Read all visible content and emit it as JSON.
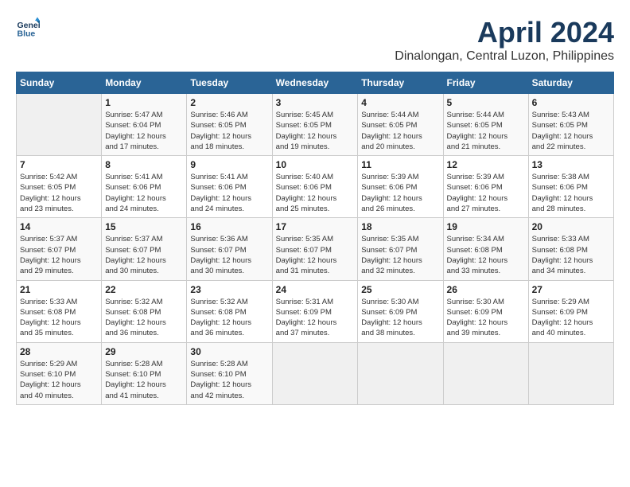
{
  "header": {
    "logo_line1": "General",
    "logo_line2": "Blue",
    "title": "April 2024",
    "subtitle": "Dinalongan, Central Luzon, Philippines"
  },
  "days_of_week": [
    "Sunday",
    "Monday",
    "Tuesday",
    "Wednesday",
    "Thursday",
    "Friday",
    "Saturday"
  ],
  "weeks": [
    [
      {
        "day": "",
        "info": ""
      },
      {
        "day": "1",
        "info": "Sunrise: 5:47 AM\nSunset: 6:04 PM\nDaylight: 12 hours\nand 17 minutes."
      },
      {
        "day": "2",
        "info": "Sunrise: 5:46 AM\nSunset: 6:05 PM\nDaylight: 12 hours\nand 18 minutes."
      },
      {
        "day": "3",
        "info": "Sunrise: 5:45 AM\nSunset: 6:05 PM\nDaylight: 12 hours\nand 19 minutes."
      },
      {
        "day": "4",
        "info": "Sunrise: 5:44 AM\nSunset: 6:05 PM\nDaylight: 12 hours\nand 20 minutes."
      },
      {
        "day": "5",
        "info": "Sunrise: 5:44 AM\nSunset: 6:05 PM\nDaylight: 12 hours\nand 21 minutes."
      },
      {
        "day": "6",
        "info": "Sunrise: 5:43 AM\nSunset: 6:05 PM\nDaylight: 12 hours\nand 22 minutes."
      }
    ],
    [
      {
        "day": "7",
        "info": "Sunrise: 5:42 AM\nSunset: 6:05 PM\nDaylight: 12 hours\nand 23 minutes."
      },
      {
        "day": "8",
        "info": "Sunrise: 5:41 AM\nSunset: 6:06 PM\nDaylight: 12 hours\nand 24 minutes."
      },
      {
        "day": "9",
        "info": "Sunrise: 5:41 AM\nSunset: 6:06 PM\nDaylight: 12 hours\nand 24 minutes."
      },
      {
        "day": "10",
        "info": "Sunrise: 5:40 AM\nSunset: 6:06 PM\nDaylight: 12 hours\nand 25 minutes."
      },
      {
        "day": "11",
        "info": "Sunrise: 5:39 AM\nSunset: 6:06 PM\nDaylight: 12 hours\nand 26 minutes."
      },
      {
        "day": "12",
        "info": "Sunrise: 5:39 AM\nSunset: 6:06 PM\nDaylight: 12 hours\nand 27 minutes."
      },
      {
        "day": "13",
        "info": "Sunrise: 5:38 AM\nSunset: 6:06 PM\nDaylight: 12 hours\nand 28 minutes."
      }
    ],
    [
      {
        "day": "14",
        "info": "Sunrise: 5:37 AM\nSunset: 6:07 PM\nDaylight: 12 hours\nand 29 minutes."
      },
      {
        "day": "15",
        "info": "Sunrise: 5:37 AM\nSunset: 6:07 PM\nDaylight: 12 hours\nand 30 minutes."
      },
      {
        "day": "16",
        "info": "Sunrise: 5:36 AM\nSunset: 6:07 PM\nDaylight: 12 hours\nand 30 minutes."
      },
      {
        "day": "17",
        "info": "Sunrise: 5:35 AM\nSunset: 6:07 PM\nDaylight: 12 hours\nand 31 minutes."
      },
      {
        "day": "18",
        "info": "Sunrise: 5:35 AM\nSunset: 6:07 PM\nDaylight: 12 hours\nand 32 minutes."
      },
      {
        "day": "19",
        "info": "Sunrise: 5:34 AM\nSunset: 6:08 PM\nDaylight: 12 hours\nand 33 minutes."
      },
      {
        "day": "20",
        "info": "Sunrise: 5:33 AM\nSunset: 6:08 PM\nDaylight: 12 hours\nand 34 minutes."
      }
    ],
    [
      {
        "day": "21",
        "info": "Sunrise: 5:33 AM\nSunset: 6:08 PM\nDaylight: 12 hours\nand 35 minutes."
      },
      {
        "day": "22",
        "info": "Sunrise: 5:32 AM\nSunset: 6:08 PM\nDaylight: 12 hours\nand 36 minutes."
      },
      {
        "day": "23",
        "info": "Sunrise: 5:32 AM\nSunset: 6:08 PM\nDaylight: 12 hours\nand 36 minutes."
      },
      {
        "day": "24",
        "info": "Sunrise: 5:31 AM\nSunset: 6:09 PM\nDaylight: 12 hours\nand 37 minutes."
      },
      {
        "day": "25",
        "info": "Sunrise: 5:30 AM\nSunset: 6:09 PM\nDaylight: 12 hours\nand 38 minutes."
      },
      {
        "day": "26",
        "info": "Sunrise: 5:30 AM\nSunset: 6:09 PM\nDaylight: 12 hours\nand 39 minutes."
      },
      {
        "day": "27",
        "info": "Sunrise: 5:29 AM\nSunset: 6:09 PM\nDaylight: 12 hours\nand 40 minutes."
      }
    ],
    [
      {
        "day": "28",
        "info": "Sunrise: 5:29 AM\nSunset: 6:10 PM\nDaylight: 12 hours\nand 40 minutes."
      },
      {
        "day": "29",
        "info": "Sunrise: 5:28 AM\nSunset: 6:10 PM\nDaylight: 12 hours\nand 41 minutes."
      },
      {
        "day": "30",
        "info": "Sunrise: 5:28 AM\nSunset: 6:10 PM\nDaylight: 12 hours\nand 42 minutes."
      },
      {
        "day": "",
        "info": ""
      },
      {
        "day": "",
        "info": ""
      },
      {
        "day": "",
        "info": ""
      },
      {
        "day": "",
        "info": ""
      }
    ]
  ]
}
